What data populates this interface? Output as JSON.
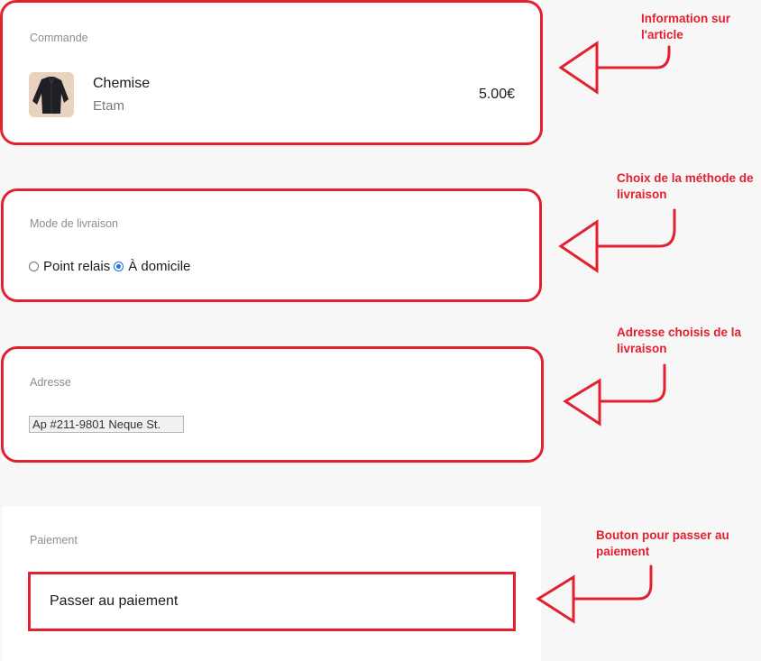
{
  "order": {
    "label": "Commande",
    "item": {
      "name": "Chemise",
      "brand": "Etam",
      "price": "5.00€"
    }
  },
  "delivery": {
    "label": "Mode de livraison",
    "options": [
      {
        "label": "Point relais",
        "selected": false
      },
      {
        "label": "À domicile",
        "selected": true
      }
    ]
  },
  "address": {
    "label": "Adresse",
    "value": "Ap #211-9801 Neque St."
  },
  "payment": {
    "label": "Paiement",
    "button_label": "Passer au paiement"
  },
  "annotations": {
    "article": "Information sur l'article",
    "delivery": "Choix de la méthode de livraison",
    "address": "Adresse choisis de la livraison",
    "payment": "Bouton pour passer au paiement"
  },
  "colors": {
    "annotation_red": "#e2202f",
    "radio_blue": "#1a73e8"
  }
}
